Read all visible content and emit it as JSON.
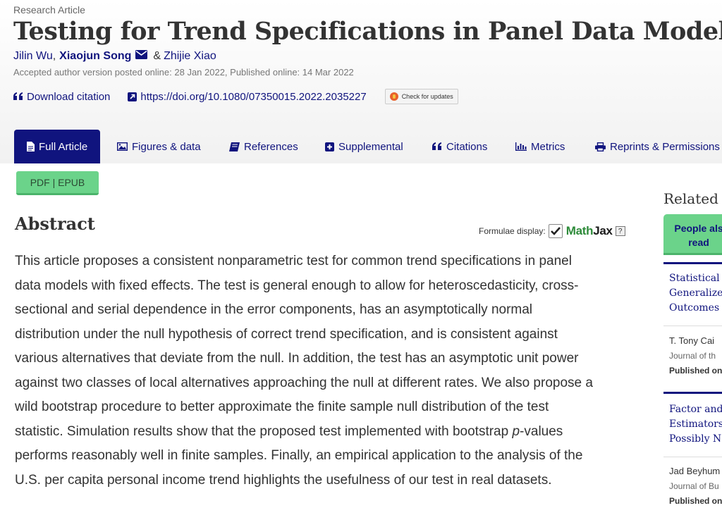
{
  "article": {
    "type": "Research Article",
    "title": "Testing for Trend Specifications in Panel Data Models",
    "authors": [
      "Jilin Wu",
      "Xiaojun Song",
      "Zhijie Xiao"
    ],
    "author_separators": [
      ",",
      "&"
    ],
    "dates": "Accepted author version posted online: 28 Jan 2022, Published online: 14 Mar 2022",
    "download_citation": "Download citation",
    "doi": "https://doi.org/10.1080/07350015.2022.2035227",
    "check_updates": "Check for updates"
  },
  "tabs": [
    {
      "label": "Full Article",
      "icon": "document-icon",
      "active": true
    },
    {
      "label": "Figures & data",
      "icon": "image-icon"
    },
    {
      "label": "References",
      "icon": "book-icon"
    },
    {
      "label": "Supplemental",
      "icon": "plus-square-icon"
    },
    {
      "label": "Citations",
      "icon": "quote-icon"
    },
    {
      "label": "Metrics",
      "icon": "bar-chart-icon"
    },
    {
      "label": "Reprints & Permissions",
      "icon": "print-icon"
    }
  ],
  "pdf_button": "PDF | EPUB",
  "abstract": {
    "heading": "Abstract",
    "formulae_label": "Formulae display:",
    "mathjax_label": "MathJax",
    "help": "?",
    "lines": [
      "This article proposes a consistent nonparametric test for common trend specifications in panel",
      "data models with fixed effects. The test is general enough to allow for heteroscedasticity, cross-",
      "sectional and serial dependence in the error components, has an asymptotically normal",
      "distribution under the null hypothesis of correct trend specification, and is consistent against",
      "various alternatives that deviate from the null. In addition, the test has an asymptotic unit power",
      "against two classes of local alternatives approaching the null at different rates. We also propose a",
      "wild bootstrap procedure to better approximate the finite sample null distribution of the test",
      [
        "statistic. Simulation results show that the proposed test implemented with bootstrap ",
        "p",
        "-values"
      ],
      "performs reasonably well in finite samples. Finally, an empirical application to the analysis of the",
      "U.S. per capita personal income trend highlights the usefulness of our test in real datasets."
    ]
  },
  "sidebar": {
    "related_title": "Related",
    "people_tab": [
      "People als",
      "read"
    ],
    "items": [
      {
        "title": [
          "Statistical",
          "Generalize",
          "Outcomes"
        ],
        "author": "T. Tony Cai",
        "journal": "Journal of th",
        "published": "Published on"
      },
      {
        "title": [
          "Factor and",
          "Estimators",
          "Possibly N"
        ],
        "author": "Jad Beyhum",
        "journal": "Journal of Bu",
        "published": "Published on"
      }
    ]
  },
  "colors": {
    "brand": "#10147e",
    "green": "#6bd38a",
    "text": "#333333"
  }
}
